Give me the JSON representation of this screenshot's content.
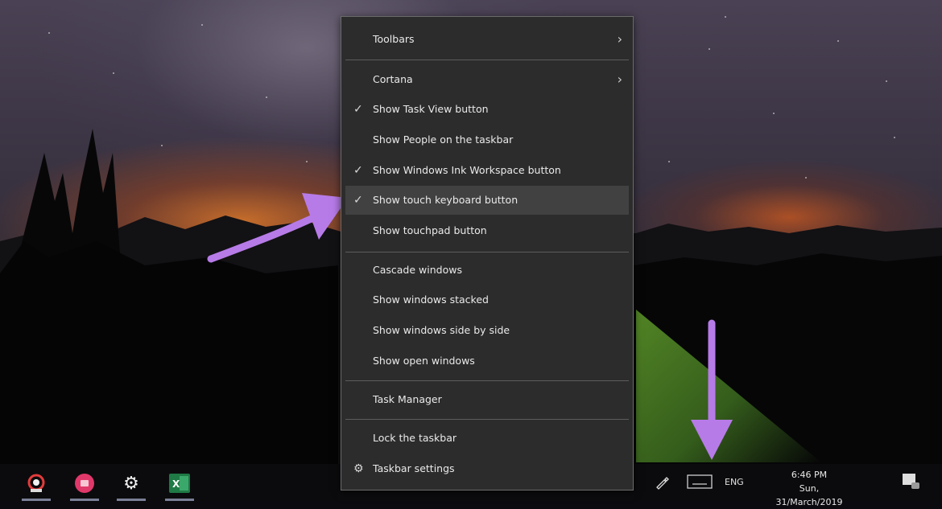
{
  "context_menu": {
    "toolbars": "Toolbars",
    "cortana": "Cortana",
    "show_task_view": "Show Task View button",
    "show_people": "Show People on the taskbar",
    "show_ink_workspace": "Show Windows Ink Workspace button",
    "show_touch_keyboard": "Show touch keyboard button",
    "show_touchpad": "Show touchpad button",
    "cascade": "Cascade windows",
    "stacked": "Show windows stacked",
    "side_by_side": "Show windows side by side",
    "open_windows": "Show open windows",
    "task_manager": "Task Manager",
    "lock_taskbar": "Lock the taskbar",
    "taskbar_settings": "Taskbar settings",
    "checked_items": [
      "Show Task View button",
      "Show Windows Ink Workspace button",
      "Show touch keyboard button"
    ],
    "highlighted_item": "Show touch keyboard button"
  },
  "taskbar": {
    "apps": [
      "chrome-like-app-icon",
      "photos-app-icon",
      "settings-gear-icon",
      "excel-icon"
    ],
    "tray": {
      "language": "ENG",
      "time": "6:46 PM",
      "date": "Sun, 31/March/2019"
    }
  },
  "icons": {
    "check": "✓",
    "chevron": "›",
    "gear": "⚙"
  },
  "colors": {
    "menu_bg": "#2c2c2c",
    "menu_hover": "#414141",
    "arrow": "#b77be8",
    "taskbar_bg": "#0c0c0e"
  }
}
